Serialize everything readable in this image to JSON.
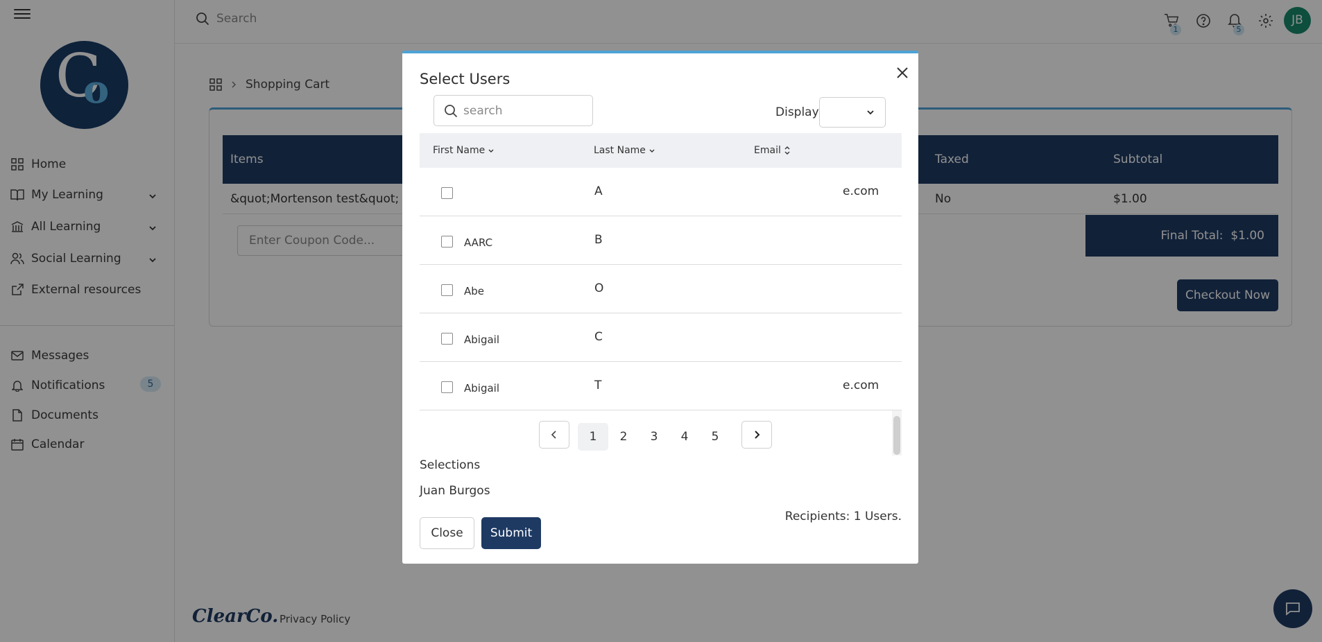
{
  "topbar": {
    "search_placeholder": "Search",
    "cart_count": "1",
    "notification_count": "5",
    "avatar_initials": "JB"
  },
  "sidebar": {
    "items": [
      {
        "label": "Home"
      },
      {
        "label": "My Learning"
      },
      {
        "label": "All Learning"
      },
      {
        "label": "Social Learning"
      },
      {
        "label": "External resources"
      },
      {
        "label": "Messages"
      },
      {
        "label": "Notifications",
        "badge": "5"
      },
      {
        "label": "Documents"
      },
      {
        "label": "Calendar"
      }
    ]
  },
  "page": {
    "breadcrumb": "Shopping Cart",
    "table_headers": {
      "items": "Items",
      "taxed": "Taxed",
      "subtotal": "Subtotal"
    },
    "row": {
      "item": "&quot;Mortenson test&quot;",
      "taxed": "No",
      "subtotal": "$1.00"
    },
    "coupon_placeholder": "Enter Coupon Code...",
    "final_total_label": "Final Total:",
    "final_total_value": "$1.00",
    "checkout_label": "Checkout Now"
  },
  "footer": {
    "brand": "ClearCo.",
    "privacy": "Privacy Policy"
  },
  "modal": {
    "title": "Select Users",
    "search_placeholder": "search",
    "display_label": "Display",
    "columns": {
      "first_name": "First Name",
      "last_name": "Last Name",
      "email": "Email"
    },
    "rows": [
      {
        "first": "",
        "last": "A",
        "email": "e.com"
      },
      {
        "first": "AARC",
        "last": "B",
        "email": ""
      },
      {
        "first": "Abe",
        "last": "O",
        "email": ""
      },
      {
        "first": "Abigail",
        "last": "C",
        "email": ""
      },
      {
        "first": "Abigail",
        "last": "T",
        "email": "e.com"
      }
    ],
    "pages": [
      "1",
      "2",
      "3",
      "4",
      "5"
    ],
    "current_page": "1",
    "selections_label": "Selections",
    "selected_user": "Juan Burgos",
    "recipients": "Recipients: 1 Users.",
    "close_label": "Close",
    "submit_label": "Submit"
  },
  "colors": {
    "primary": "#1e3a63",
    "accent": "#4da3d6",
    "avatar": "#178a6c"
  }
}
